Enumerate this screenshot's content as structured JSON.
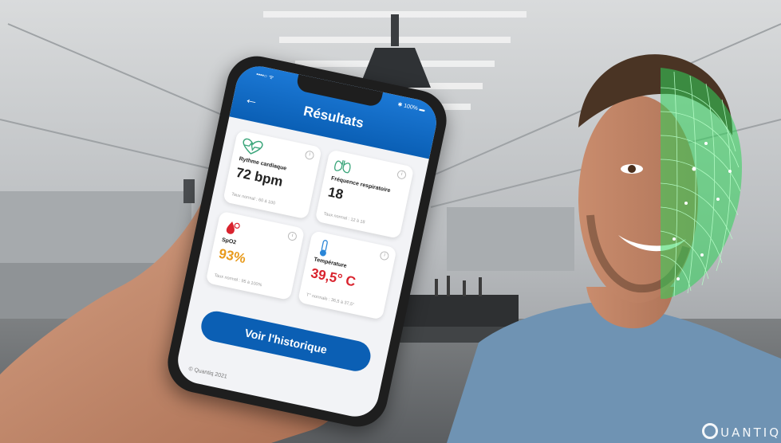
{
  "phone": {
    "status_left": "••••○ ᯤ",
    "status_right": "✱ 100% ▬",
    "back_icon": "arrow-left-icon",
    "header_title": "Résultats",
    "cards": [
      {
        "icon": "heart-pulse-icon",
        "label": "Rythme cardiaque",
        "value": "72 bpm",
        "normal": "Taux normal : 60 à 100",
        "value_color": "#222222"
      },
      {
        "icon": "lungs-icon",
        "label": "Fréquence respiratoire",
        "value": "18",
        "normal": "Taux normal : 12 à 18",
        "value_color": "#222222"
      },
      {
        "icon": "blood-drop-icon",
        "label": "SpO2",
        "value": "93%",
        "normal": "Taux normal : 95 à 100%",
        "value_color": "#e89a1c"
      },
      {
        "icon": "thermometer-icon",
        "label": "Température",
        "value": "39,5° C",
        "normal": "T° normale : 36,5 à 37,5°",
        "value_color": "#d9232e"
      }
    ],
    "cta_label": "Voir l'historique",
    "copyright": "© Quantiq 2021"
  },
  "branding": {
    "logo_text": "UANTIQ",
    "accent": "#0b5fb4",
    "face_mesh_color": "#2fd35a"
  }
}
